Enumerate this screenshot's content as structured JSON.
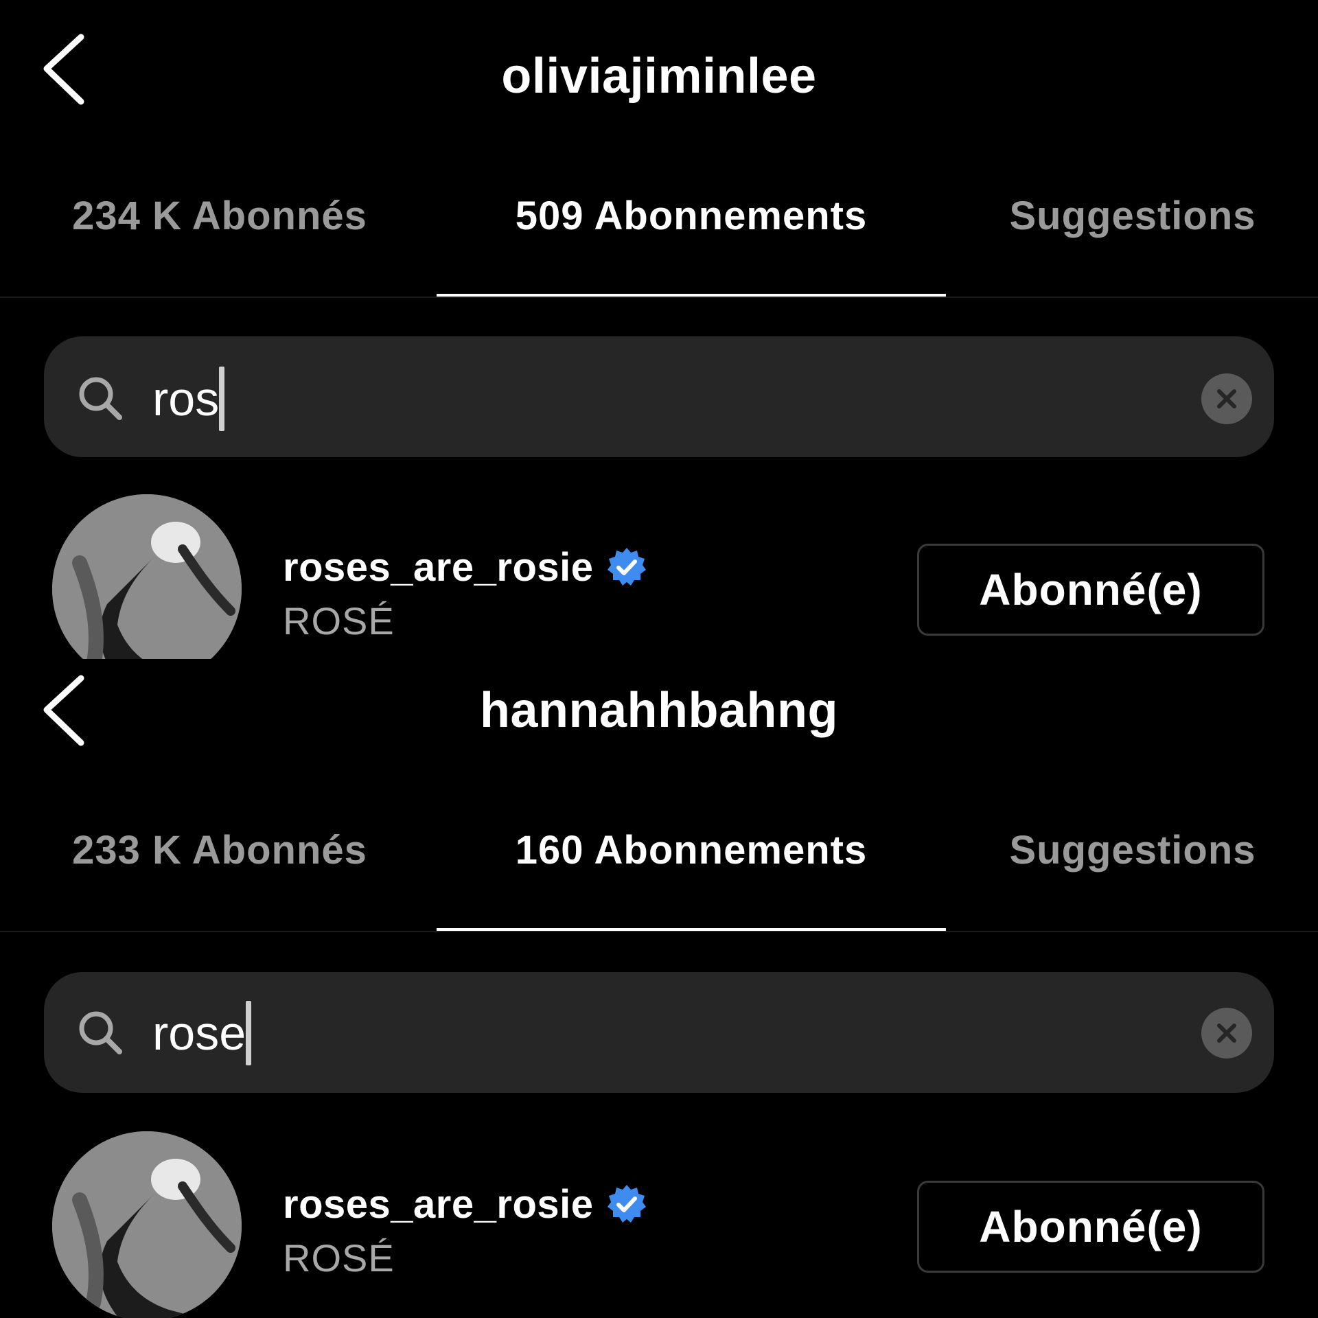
{
  "panels": [
    {
      "title": "oliviajiminlee",
      "tabs": [
        {
          "label": "234 K Abonnés",
          "active": false
        },
        {
          "label": "509 Abonnements",
          "active": true
        },
        {
          "label": "Suggestions",
          "active": false
        }
      ],
      "search": {
        "value": "ros",
        "icons": {
          "left": "search-icon",
          "right": "clear-icon"
        }
      },
      "result": {
        "username": "roses_are_rosie",
        "verified": true,
        "full_name": "ROSÉ",
        "button_label": "Abonné(e)"
      }
    },
    {
      "title": "hannahhbahng",
      "tabs": [
        {
          "label": "233 K Abonnés",
          "active": false
        },
        {
          "label": "160 Abonnements",
          "active": true
        },
        {
          "label": "Suggestions",
          "active": false
        }
      ],
      "search": {
        "value": "rose",
        "icons": {
          "left": "search-icon",
          "right": "clear-icon"
        }
      },
      "result": {
        "username": "roses_are_rosie",
        "verified": true,
        "full_name": "ROSÉ",
        "button_label": "Abonné(e)"
      }
    }
  ],
  "colors": {
    "background": "#000000",
    "search_field": "#262626",
    "inactive_tab": "#9a9a9a",
    "verified_badge": "#3f8cf0",
    "secondary_text": "#a8a8a8"
  }
}
